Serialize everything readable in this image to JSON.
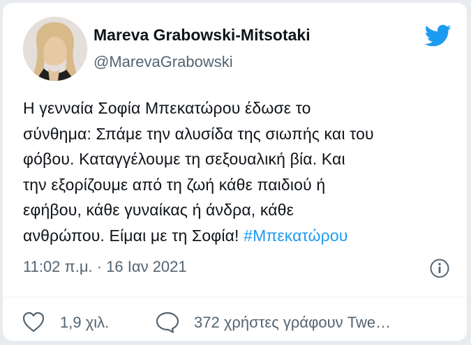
{
  "tweet": {
    "author_name": "Mareva Grabowski-Mitsotaki",
    "author_handle": "@MarevaGrabowski",
    "text_lines": [
      "Η γενναία Σοφία Μπεκατώρου έδωσε το",
      "σύνθημα: Σπάμε την αλυσίδα της σιωπής και του",
      "φόβου. Καταγγέλουμε τη σεξουαλική βία. Και",
      "την εξορίζουμε από τη ζωή κάθε παιδιού ή",
      "εφήβου, κάθε γυναίκας ή άνδρα, κάθε"
    ],
    "last_line_text": "ανθρώπου. Είμαι με τη Σοφία! ",
    "hashtag": "#Μπεκατώρου",
    "timestamp": "11:02 π.μ. · 16 Ιαν 2021",
    "likes_count": "1,9 χιλ.",
    "replies_text": "372 χρήστες γράφουν Twe…"
  },
  "icons": {
    "brand": "twitter-bird-icon",
    "info": "info-icon",
    "like": "heart-icon",
    "reply": "speech-bubble-icon"
  },
  "colors": {
    "brand_blue": "#1d9bf0",
    "text": "#0f1419",
    "muted": "#536471"
  }
}
